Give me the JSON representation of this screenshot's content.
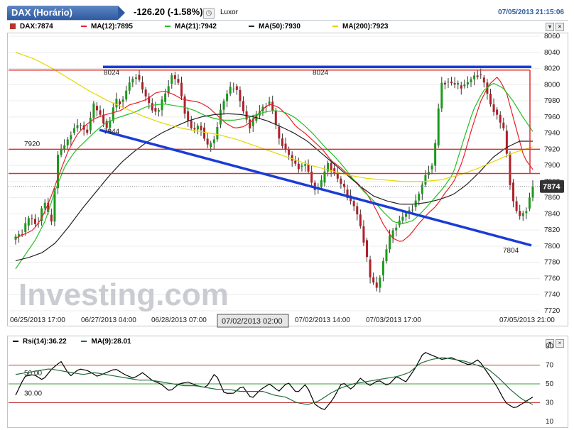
{
  "header": {
    "title": "DAX (Horário)",
    "change": "-126.20 (-1.58%)",
    "city": "Luxor",
    "timestamp": "07/05/2013 21:15:06"
  },
  "legend": [
    {
      "label": "DAX:7874",
      "color": "#b8342c"
    },
    {
      "label": "MA(12):7895",
      "color": "#e8202a"
    },
    {
      "label": "MA(21):7942",
      "color": "#22c022"
    },
    {
      "label": "MA(50):7930",
      "color": "#222222"
    },
    {
      "label": "MA(200):7923",
      "color": "#e6d600"
    }
  ],
  "watermark": "Investing.com",
  "chart_data": [
    {
      "type": "candlestick",
      "ylim": [
        7720,
        8060
      ],
      "yticks": [
        "7720",
        "7740",
        "7760",
        "7780",
        "7800",
        "7820",
        "7840",
        "7860",
        "7880",
        "7900",
        "7920",
        "7940",
        "7960",
        "7980",
        "8000",
        "8020",
        "8040",
        "8060"
      ],
      "xticks": [
        "06/25/2013 17:00",
        "06/27/2013 04:00",
        "06/28/2013 07:00",
        "07/02/2013 02:00",
        "07/02/2013 14:00",
        "07/03/2013 17:00",
        "07/05/2013 21:00"
      ],
      "x_highlight": "07/02/2013 02:00",
      "last_price": "7874",
      "hlines": [
        8018,
        7920,
        7890
      ],
      "trendlines": [
        [
          8022,
          8022
        ],
        [
          7944,
          7801
        ]
      ],
      "annotations": [
        "8024",
        "8024",
        "7920",
        "7944",
        "7804"
      ],
      "ohlc_stats": {
        "n": 160
      },
      "anchors": [
        7812,
        7818,
        7838,
        7824,
        7858,
        7826,
        7916,
        7926,
        7944,
        7952,
        7940,
        7974,
        7962,
        7944,
        7980,
        7978,
        8002,
        8012,
        7992,
        7974,
        7964,
        7986,
        8012,
        8002,
        7962,
        7942,
        7952,
        7922,
        7932,
        7972,
        7992,
        8000,
        7970,
        7948,
        7962,
        7974,
        7980,
        7936,
        7922,
        7906,
        7898,
        7902,
        7872,
        7874,
        7904,
        7890,
        7876,
        7860,
        7846,
        7814,
        7762,
        7748,
        7786,
        7816,
        7830,
        7840,
        7848,
        7866,
        7892,
        7902,
        8002,
        8004,
        8000,
        7998,
        8004,
        8014,
        8006,
        7976,
        7962,
        7940,
        7862,
        7836,
        7844,
        7874
      ],
      "series": [
        {
          "name": "MA(12)",
          "anchors": [
            7810,
            7815,
            7820,
            7835,
            7860,
            7890,
            7918,
            7938,
            7950,
            7958,
            7962,
            7965,
            7968,
            7975,
            7978,
            7982,
            7990,
            7992,
            7988,
            7982,
            7980,
            7978,
            7972,
            7962,
            7952,
            7946,
            7948,
            7955,
            7968,
            7976,
            7972,
            7962,
            7948,
            7940,
            7930,
            7920,
            7906,
            7898,
            7888,
            7878,
            7866,
            7848,
            7826,
            7810,
            7805,
            7814,
            7828,
            7840,
            7850,
            7866,
            7880,
            7906,
            7944,
            7978,
            8000,
            8010,
            7990,
            7950,
            7910,
            7895
          ]
        },
        {
          "name": "MA(21)",
          "anchors": [
            7772,
            7790,
            7808,
            7832,
            7870,
            7900,
            7918,
            7930,
            7942,
            7952,
            7958,
            7962,
            7966,
            7972,
            7975,
            7976,
            7974,
            7972,
            7968,
            7962,
            7958,
            7956,
            7956,
            7958,
            7962,
            7966,
            7968,
            7966,
            7960,
            7950,
            7938,
            7924,
            7912,
            7898,
            7882,
            7868,
            7856,
            7842,
            7830,
            7828,
            7832,
            7844,
            7858,
            7872,
            7890,
            7930,
            7968,
            7992,
            8002,
            7996,
            7980,
            7960,
            7942
          ]
        },
        {
          "name": "MA(50)",
          "anchors": [
            7782,
            7786,
            7792,
            7804,
            7824,
            7846,
            7866,
            7886,
            7904,
            7918,
            7930,
            7940,
            7948,
            7955,
            7960,
            7963,
            7964,
            7963,
            7960,
            7955,
            7948,
            7940,
            7930,
            7916,
            7902,
            7888,
            7874,
            7862,
            7856,
            7852,
            7852,
            7854,
            7858,
            7864,
            7876,
            7892,
            7910,
            7922,
            7930,
            7930
          ]
        },
        {
          "name": "MA(200)",
          "anchors": [
            8040,
            8032,
            8020,
            8006,
            7992,
            7980,
            7970,
            7960,
            7952,
            7946,
            7942,
            7938,
            7932,
            7924,
            7916,
            7908,
            7900,
            7894,
            7888,
            7884,
            7882,
            7880,
            7880,
            7882,
            7888,
            7896,
            7906,
            7916,
            7923
          ]
        }
      ]
    },
    {
      "type": "line",
      "ylim": [
        10,
        90
      ],
      "yticks": [
        "10",
        "30",
        "50",
        "70",
        "90"
      ],
      "levels": [
        30,
        50,
        70
      ],
      "level_labels": [
        "50.00",
        "30.00"
      ],
      "legend": [
        {
          "label": "Rsi(14):36.22",
          "color": "#000000"
        },
        {
          "label": "MA(9):28.01",
          "color": "#1f6e3a"
        }
      ],
      "series": [
        {
          "name": "Rsi(14)",
          "anchors": [
            38,
            58,
            60,
            54,
            66,
            74,
            58,
            66,
            64,
            58,
            62,
            66,
            60,
            56,
            62,
            54,
            50,
            42,
            50,
            52,
            48,
            46,
            62,
            40,
            40,
            48,
            34,
            44,
            50,
            42,
            52,
            40,
            50,
            28,
            22,
            34,
            52,
            44,
            56,
            48,
            54,
            48,
            58,
            52,
            66,
            84,
            80,
            76,
            78,
            74,
            70,
            76,
            62,
            48,
            30,
            24,
            30,
            36
          ]
        },
        {
          "name": "MA(9)",
          "anchors": [
            60,
            62,
            64,
            66,
            64,
            62,
            60,
            62,
            60,
            58,
            56,
            54,
            54,
            52,
            50,
            48,
            48,
            46,
            44,
            44,
            42,
            42,
            42,
            38,
            36,
            30,
            28,
            32,
            40,
            46,
            50,
            52,
            54,
            56,
            58,
            62,
            72,
            76,
            78,
            76,
            74,
            70,
            66,
            56,
            44,
            34,
            28
          ]
        }
      ]
    }
  ]
}
